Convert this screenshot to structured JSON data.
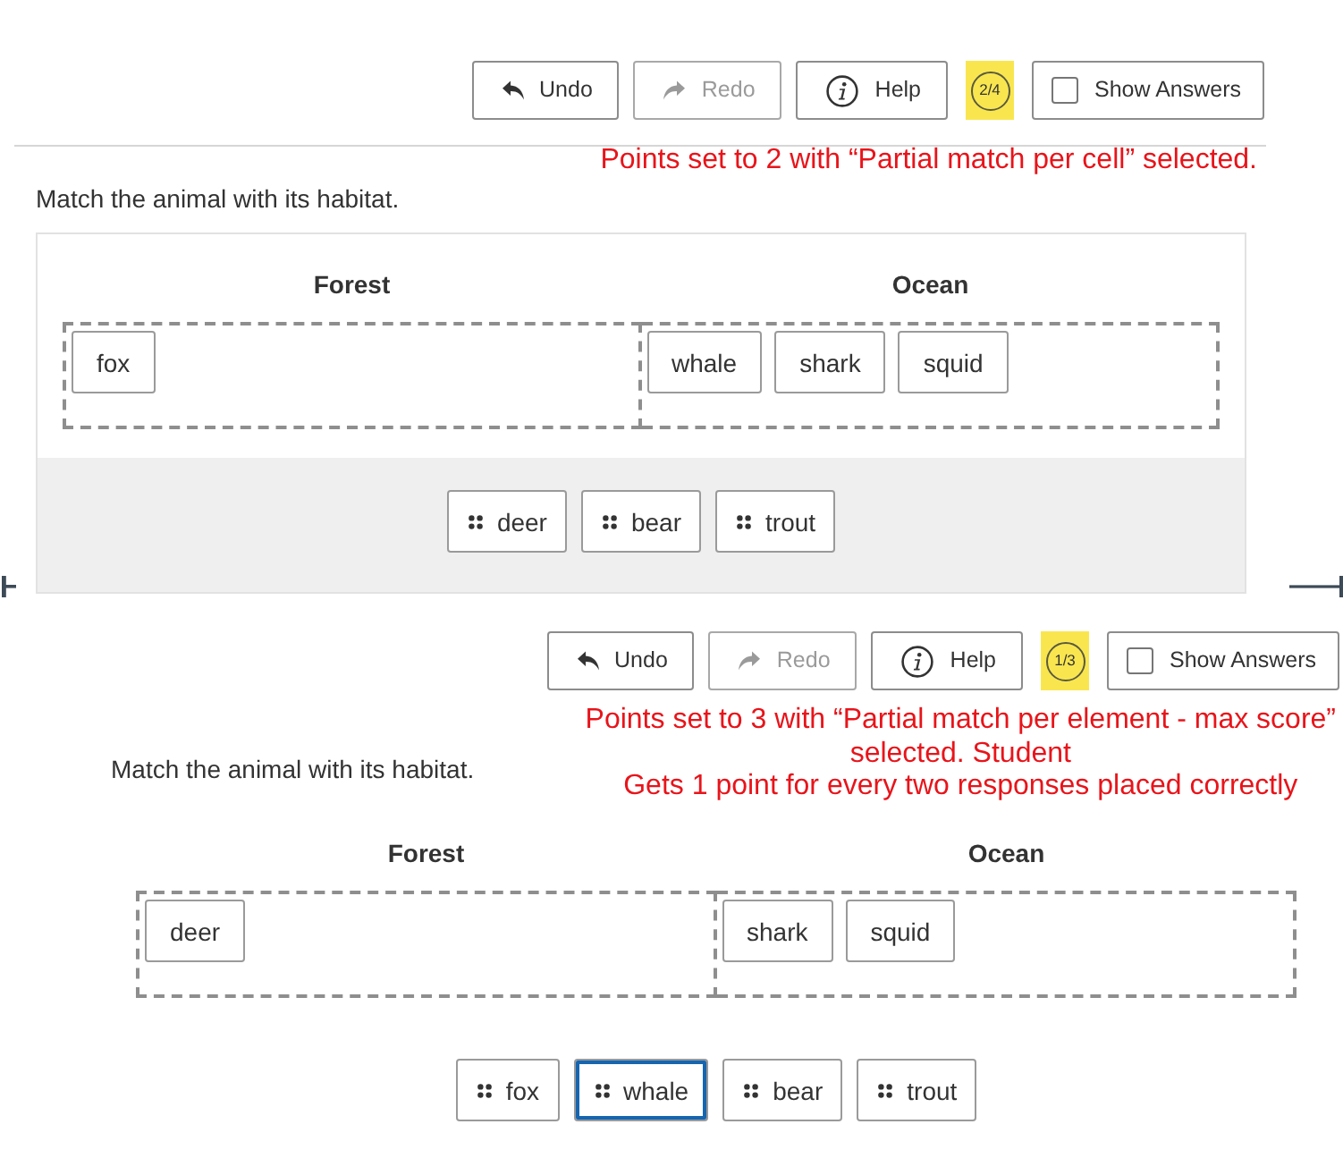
{
  "sections": [
    {
      "kind": "boxed",
      "toolbar": {
        "buttons": [
          {
            "kind": "undo",
            "label": "Undo",
            "disabled": false
          },
          {
            "kind": "redo",
            "label": "Redo",
            "disabled": true
          },
          {
            "kind": "help",
            "label": "Help",
            "disabled": false
          }
        ],
        "score": "2/4",
        "show_answers": {
          "label": "Show Answers",
          "checked": false
        }
      },
      "note": [
        "Points set to 2 with “Partial match per cell” selected."
      ],
      "prompt": "Match the animal with its habitat.",
      "columns": [
        {
          "heading": "Forest",
          "responses": [
            "fox"
          ]
        },
        {
          "heading": "Ocean",
          "responses": [
            "whale",
            "shark",
            "squid"
          ]
        }
      ],
      "bank": [
        {
          "label": "deer",
          "selected": false
        },
        {
          "label": "bear",
          "selected": false
        },
        {
          "label": "trout",
          "selected": false
        }
      ]
    },
    {
      "kind": "plain",
      "toolbar": {
        "buttons": [
          {
            "kind": "undo",
            "label": "Undo",
            "disabled": false
          },
          {
            "kind": "redo",
            "label": "Redo",
            "disabled": true
          },
          {
            "kind": "help",
            "label": "Help",
            "disabled": false
          }
        ],
        "score": "1/3",
        "show_answers": {
          "label": "Show Answers",
          "checked": false
        }
      },
      "note": [
        "Points set to 3 with “Partial match per element - max score”",
        "selected. Student",
        "Gets 1 point for every two responses placed correctly"
      ],
      "prompt": "Match the animal with its habitat.",
      "columns": [
        {
          "heading": "Forest",
          "responses": [
            "deer"
          ]
        },
        {
          "heading": "Ocean",
          "responses": [
            "shark",
            "squid"
          ]
        }
      ],
      "bank": [
        {
          "label": "fox",
          "selected": false
        },
        {
          "label": "whale",
          "selected": true
        },
        {
          "label": "bear",
          "selected": false
        },
        {
          "label": "trout",
          "selected": false
        }
      ]
    }
  ]
}
